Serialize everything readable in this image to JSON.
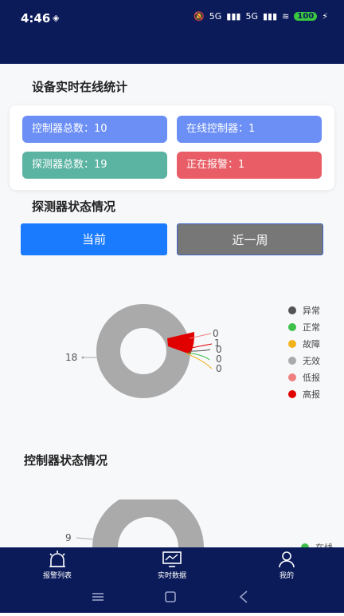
{
  "status_bar": {
    "time": "4:46",
    "battery": "100",
    "network_1": "5G",
    "network_2": "5G"
  },
  "titles": {
    "online_stats": "设备实时在线统计",
    "detector_status": "探测器状态情况",
    "controller_status": "控制器状态情况"
  },
  "stats": [
    {
      "label": "控制器总数：10",
      "color": "#6b8ff5"
    },
    {
      "label": "在线控制器：1",
      "color": "#6b8ff5"
    },
    {
      "label": "探测器总数：19",
      "color": "#5bb3a2"
    },
    {
      "label": "正在报警：1",
      "color": "#e85d66"
    }
  ],
  "tabs": {
    "current": "当前",
    "week": "近一周"
  },
  "detector_chart": {
    "chart_data": {
      "type": "pie",
      "categories": [
        "异常",
        "正常",
        "故障",
        "无效",
        "低报",
        "高报"
      ],
      "values": [
        0,
        0,
        0,
        18,
        0,
        1
      ],
      "colors": [
        "#555555",
        "#3dbf4a",
        "#f2b21b",
        "#aaaaaa",
        "#f08080",
        "#e00000"
      ],
      "legend_position": "right"
    },
    "labels": [
      "18",
      "0",
      "1",
      "0",
      "0",
      "0"
    ]
  },
  "controller_chart": {
    "label_left": "9",
    "legend_partial": "在线"
  },
  "legend": [
    {
      "label": "异常",
      "color": "#555555"
    },
    {
      "label": "正常",
      "color": "#3dbf4a"
    },
    {
      "label": "故障",
      "color": "#f2b21b"
    },
    {
      "label": "无效",
      "color": "#aaaaaa"
    },
    {
      "label": "低报",
      "color": "#f08080"
    },
    {
      "label": "高报",
      "color": "#e00000"
    }
  ],
  "nav": {
    "alarm": "报警列表",
    "realtime": "实时数据",
    "mine": "我的"
  },
  "icons": {
    "alarm": "alarm-light-icon",
    "realtime": "monitor-icon",
    "mine": "person-icon"
  }
}
